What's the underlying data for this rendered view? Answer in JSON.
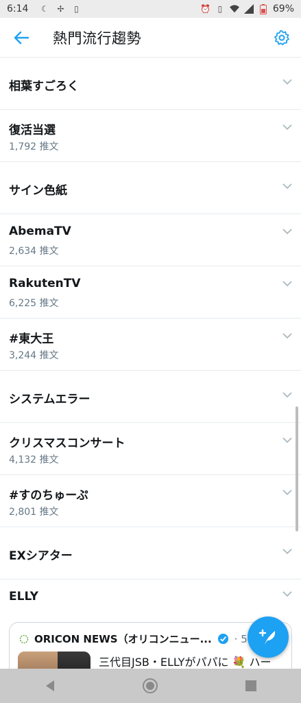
{
  "status_bar": {
    "time": "6:14",
    "battery": "69%",
    "icons": [
      "moon-icon",
      "fan-icon",
      "sim-icon",
      "alarm-icon",
      "vibrate-icon",
      "wifi-icon",
      "signal-icon",
      "battery-icon"
    ]
  },
  "header": {
    "title": "熱門流行趨勢",
    "back_icon": "back-arrow-icon",
    "settings_icon": "gear-icon"
  },
  "trends": [
    {
      "name": "相葉すごろく",
      "count": ""
    },
    {
      "name": "復活当選",
      "count": "1,792 推文"
    },
    {
      "name": "サイン色紙",
      "count": ""
    },
    {
      "name": "AbemaTV",
      "count": "2,634 推文"
    },
    {
      "name": "RakutenTV",
      "count": "6,225 推文"
    },
    {
      "name": "#東大王",
      "count": "3,244 推文"
    },
    {
      "name": "システムエラー",
      "count": ""
    },
    {
      "name": "クリスマスコンサート",
      "count": "4,132 推文"
    },
    {
      "name": "#すのちゅーぷ",
      "count": "2,801 推文"
    },
    {
      "name": "EXシアター",
      "count": ""
    },
    {
      "name": "ELLY",
      "count": ""
    }
  ],
  "tweet_card": {
    "author": "ORICON NEWS（オリコンニュー...",
    "time_partial": "· 5",
    "text": "三代目JSB・ELLYがパパに 💐 ハー"
  },
  "colors": {
    "accent": "#1da1f2",
    "secondary_text": "#657786",
    "divider": "#e6ecf0",
    "chevron": "#aab8c2"
  }
}
